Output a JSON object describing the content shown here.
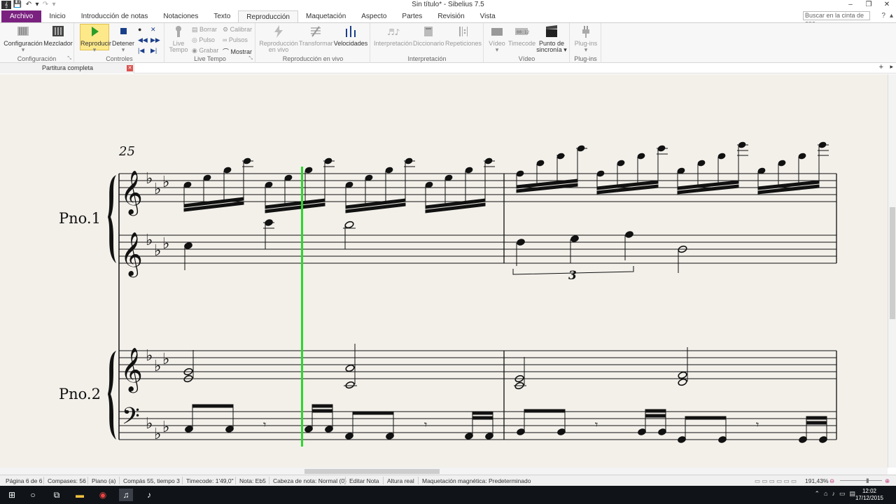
{
  "window": {
    "title": "Sin título* - Sibelius 7.5",
    "minimize_icon": "minimize-icon",
    "maximize_icon": "restore-icon",
    "close_icon": "close-icon"
  },
  "tabs": [
    {
      "label": "Archivo"
    },
    {
      "label": "Inicio"
    },
    {
      "label": "Introducción de notas"
    },
    {
      "label": "Notaciones"
    },
    {
      "label": "Texto"
    },
    {
      "label": "Reproducción"
    },
    {
      "label": "Maquetación"
    },
    {
      "label": "Aspecto"
    },
    {
      "label": "Partes"
    },
    {
      "label": "Revisión"
    },
    {
      "label": "Vista"
    }
  ],
  "search": {
    "placeholder": "Buscar en la cinta de opc..."
  },
  "ribbon": {
    "configuracion": {
      "label": "Configuración",
      "mezclador": "Mezclador",
      "group": "Configuración"
    },
    "controles": {
      "reproducir": "Reproducir",
      "detener": "Detener",
      "group": "Controles"
    },
    "live_tempo": {
      "live": "Live",
      "tempo": "Tempo",
      "borrar": "Borrar",
      "pulso": "Pulso",
      "grabar": "Grabar",
      "calibrar": "Calibrar",
      "pulsos": "Pulsos",
      "mostrar": "Mostrar",
      "group": "Live Tempo"
    },
    "reproduccion_en_vivo": {
      "btn1": "Reproducción",
      "btn1b": "en vivo",
      "transformar": "Transformar",
      "velocidades": "Velocidades",
      "group": "Reproducción en vivo"
    },
    "interpretacion": {
      "interpretacion": "Interpretación",
      "diccionario": "Diccionario",
      "repeticiones": "Repeticiones",
      "group": "Interpretación"
    },
    "video": {
      "video": "Vídeo",
      "timecode": "Timecode",
      "punto": "Punto de",
      "sincronia": "sincronía",
      "group": "Vídeo"
    },
    "plugins": {
      "label": "Plug-ins",
      "group": "Plug-ins"
    }
  },
  "doc_tab": {
    "label": "Partitura completa"
  },
  "score": {
    "measure_number": "25",
    "instrument_1": "Pno.1",
    "instrument_2": "Pno.2",
    "tuplet": "3"
  },
  "status": {
    "page": "Página 6 de 6",
    "bars": "Compases: 56",
    "instrument": "Piano (a)",
    "position": "Compás 55, tiempo 3",
    "timecode": "Timecode: 1'49,0\"",
    "note": "Nota: Eb5",
    "notehead": "Cabeza de nota: Normal (0)",
    "edit": "Editar Nota",
    "pitch": "Altura real",
    "magnetic": "Maquetación magnética: Predeterminado",
    "zoom": "191,43%"
  },
  "taskbar": {
    "time": "12:02",
    "date": "17/12/2015"
  },
  "colors": {
    "file_tab": "#7a2180",
    "playline": "#2bd82b",
    "paper": "#f3f0ea"
  }
}
